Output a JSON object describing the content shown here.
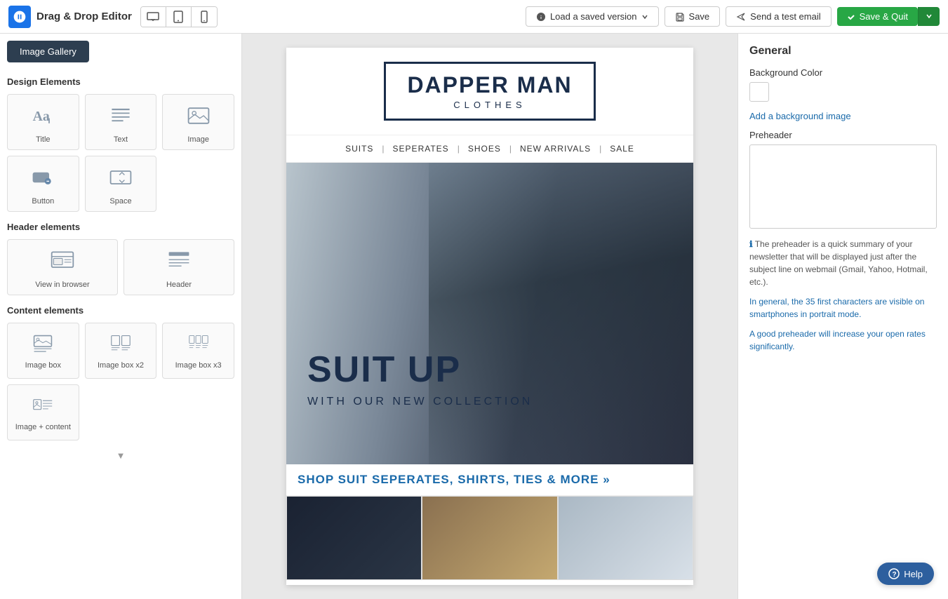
{
  "app": {
    "title": "Drag & Drop Editor"
  },
  "topbar": {
    "load_version_label": "Load a saved version",
    "save_label": "Save",
    "send_test_label": "Send a test email",
    "save_quit_label": "Save & Quit"
  },
  "sidebar": {
    "gallery_button": "Image Gallery",
    "design_elements_title": "Design Elements",
    "header_elements_title": "Header elements",
    "content_elements_title": "Content elements",
    "design_elements": [
      {
        "id": "title",
        "label": "Title"
      },
      {
        "id": "text",
        "label": "Text"
      },
      {
        "id": "image",
        "label": "Image"
      },
      {
        "id": "button",
        "label": "Button"
      },
      {
        "id": "space",
        "label": "Space"
      }
    ],
    "header_elements": [
      {
        "id": "view-in-browser",
        "label": "View in browser"
      },
      {
        "id": "header",
        "label": "Header"
      }
    ],
    "content_elements": [
      {
        "id": "image-box",
        "label": "Image box"
      },
      {
        "id": "image-box-x2",
        "label": "Image box x2"
      },
      {
        "id": "image-box-x3",
        "label": "Image box x3"
      },
      {
        "id": "image-content",
        "label": "Image + content"
      }
    ]
  },
  "email": {
    "logo_title": "DAPPER MAN",
    "logo_subtitle": "CLOTHES",
    "nav_items": [
      "SUITS",
      "SEPERATES",
      "SHOES",
      "NEW ARRIVALS",
      "SALE"
    ],
    "hero_title_line1": "SUIT UP",
    "hero_subtitle": "WITH OUR NEW COLLECTION",
    "shop_link": "SHOP SUIT SEPERATES, SHIRTS, TIES & MORE »"
  },
  "right_panel": {
    "title": "General",
    "background_color_label": "Background Color",
    "add_bg_image_label": "Add a background image",
    "preheader_label": "Preheader",
    "preheader_placeholder": "",
    "info_text": "The preheader is a quick summary of your newsletter that will be displayed just after the subject line on webmail (Gmail, Yahoo, Hotmail, etc.).",
    "info_text2": "In general, the 35 first characters are visible on smartphones in portrait mode.",
    "info_text3": "A good preheader will increase your open rates significantly."
  },
  "help": {
    "label": "Help"
  }
}
